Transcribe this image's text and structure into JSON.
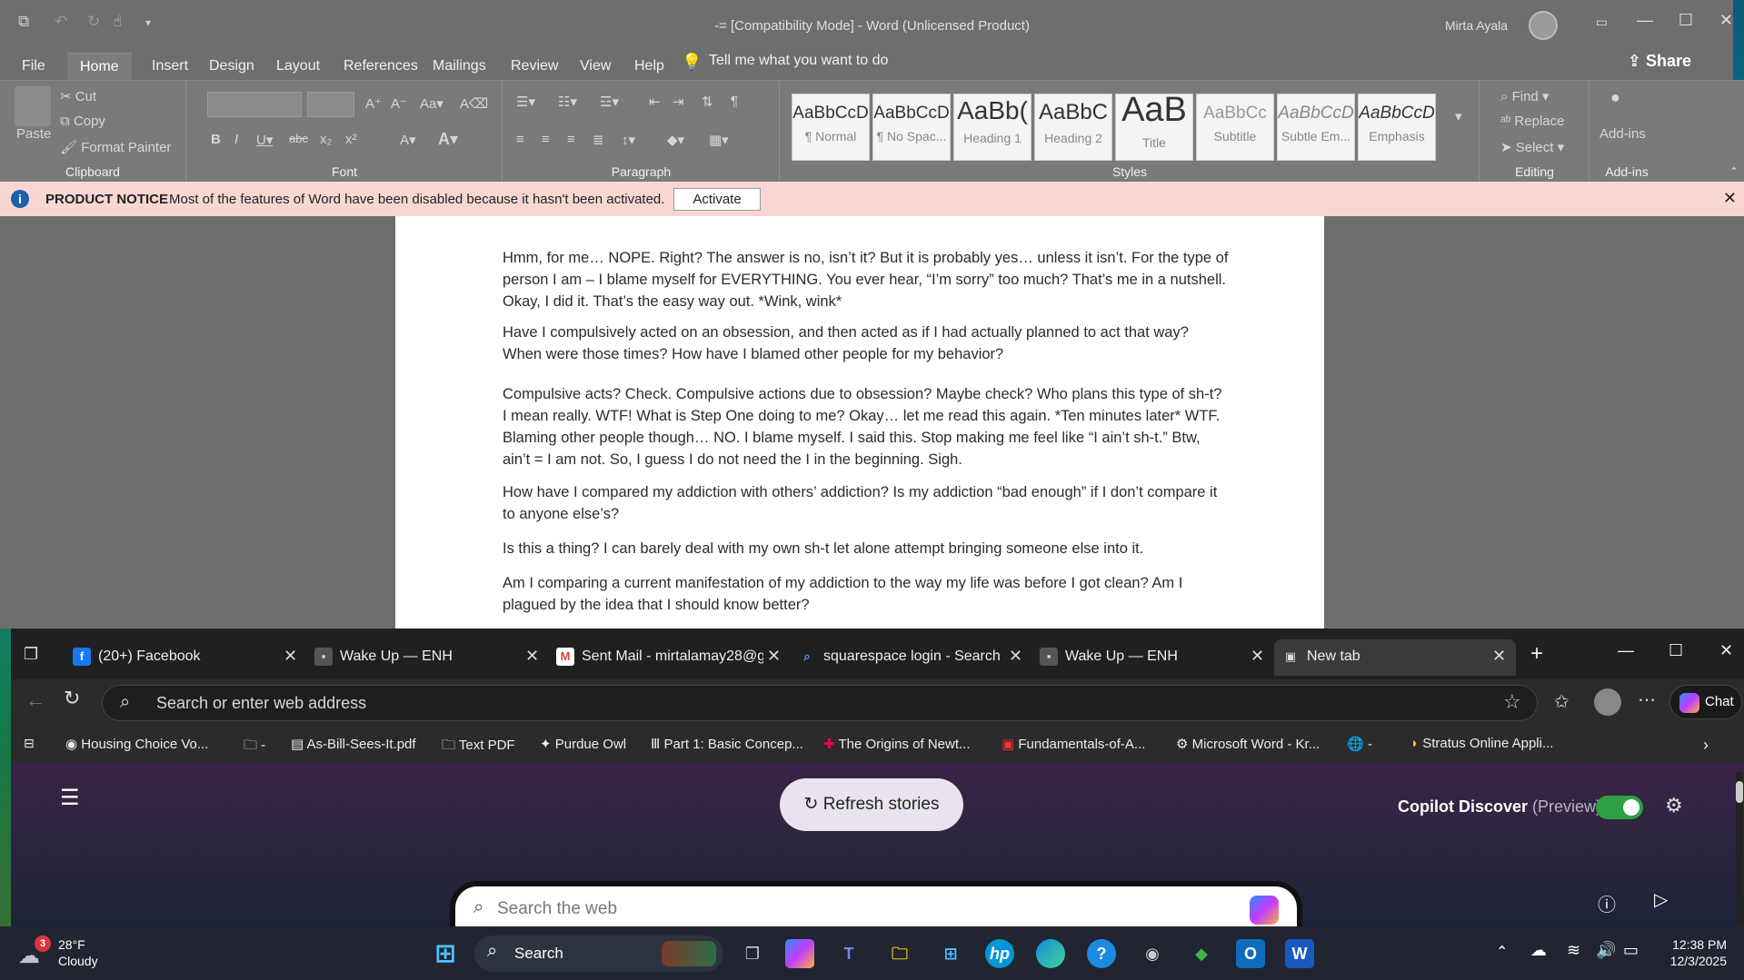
{
  "word": {
    "title": "-= [Compatibility Mode]  -  Word (Unlicensed Product)",
    "user": "Mirta Ayala",
    "share": "Share",
    "tabs": [
      "File",
      "Home",
      "Insert",
      "Design",
      "Layout",
      "References",
      "Mailings",
      "Review",
      "View",
      "Help"
    ],
    "tell_me": "Tell me what you want to do",
    "clipboard": {
      "paste": "Paste",
      "cut": "Cut",
      "copy": "Copy",
      "format_painter": "Format Painter",
      "label": "Clipboard"
    },
    "font_label": "Font",
    "paragraph_label": "Paragraph",
    "styles_label": "Styles",
    "styles": [
      {
        "preview": "AaBbCcD",
        "name": "¶ Normal"
      },
      {
        "preview": "AaBbCcD",
        "name": "¶ No Spac..."
      },
      {
        "preview": "AaBb(",
        "name": "Heading 1"
      },
      {
        "preview": "AaBbC",
        "name": "Heading 2"
      },
      {
        "preview": "AaB",
        "name": "Title"
      },
      {
        "preview": "AaBbCc",
        "name": "Subtitle"
      },
      {
        "preview": "AaBbCcD",
        "name": "Subtle Em..."
      },
      {
        "preview": "AaBbCcD",
        "name": "Emphasis"
      }
    ],
    "editing": {
      "find": "Find",
      "replace": "Replace",
      "select": "Select",
      "label": "Editing"
    },
    "addins": {
      "addins": "Add-ins",
      "label": "Add-ins"
    },
    "notice": {
      "title": "PRODUCT NOTICE",
      "text": "Most of the features of Word have been disabled because it hasn't been activated.",
      "button": "Activate"
    },
    "paragraphs": [
      "Hmm, for me… NOPE. Right? The answer is no, isn’t it? But it is probably yes… unless it isn’t. For the type of person I am – I blame myself for EVERYTHING. You ever hear, “I’m sorry” too much? That’s me in a nutshell. Okay, I did it. That’s the easy way out. *Wink, wink*",
      "Have I compulsively acted on an obsession, and then acted as if I had actually planned to act that way? When were those times? How have I blamed other people for my behavior?",
      "Compulsive acts? Check. Compulsive actions due to obsession? Maybe check? Who plans this type of sh-t? I mean really. WTF! What is Step One doing to me? Okay… let me read this again. *Ten minutes later* WTF. Blaming other people though… NO. I blame myself. I said this. Stop making me feel like “I ain’t sh-t.” Btw, ain’t = I am not. So, I guess I do not need the I in the beginning. Sigh.",
      "How have I compared my addiction with others’ addiction? Is my addiction “bad enough” if I don’t compare it to anyone else’s?",
      "Is this a thing? I can barely deal with my own sh-t let alone attempt bringing someone else into it.",
      "Am I comparing a current manifestation of my addiction to the way my life was before I got clean? Am I plagued by the idea that I should know better?"
    ]
  },
  "browser": {
    "tabs": [
      {
        "title": "(20+) Facebook",
        "icon": "facebook-icon"
      },
      {
        "title": "Wake Up — ENH",
        "icon": "page-icon"
      },
      {
        "title": "Sent Mail - mirtalamay28@g",
        "icon": "gmail-icon"
      },
      {
        "title": "squarespace login - Search",
        "icon": "search-icon"
      },
      {
        "title": "Wake Up — ENH",
        "icon": "page-icon"
      },
      {
        "title": "New tab",
        "icon": "newtab-icon"
      }
    ],
    "address_placeholder": "Search or enter web address",
    "chat": "Chat",
    "bookmarks": [
      "Housing Choice Vo...",
      "-",
      "As-Bill-Sees-It.pdf",
      "Text PDF",
      "Purdue Owl",
      "Part 1: Basic Concep...",
      "The Origins of Newt...",
      "Fundamentals-of-A...",
      "Microsoft Word - Kr...",
      "-",
      "Stratus Online Appli..."
    ],
    "refresh": "Refresh stories",
    "copilot_discover": "Copilot Discover",
    "preview": "(Preview)",
    "search_placeholder": "Search the web"
  },
  "taskbar": {
    "weather_temp": "28°F",
    "weather_cond": "Cloudy",
    "weather_badge": "3",
    "search": "Search",
    "time": "12:38 PM",
    "date": "12/3/2025"
  }
}
